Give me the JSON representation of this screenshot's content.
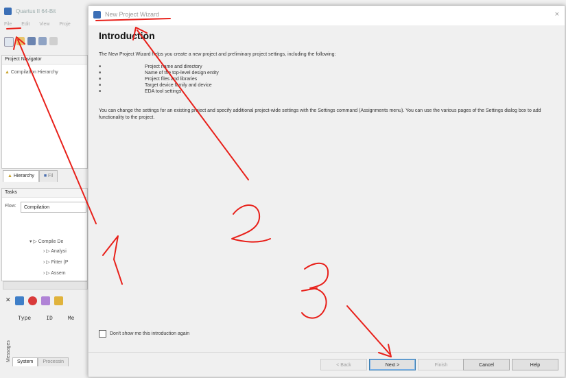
{
  "main_window": {
    "title": "Quartus II 64-Bit",
    "menu": [
      "File",
      "Edit",
      "View",
      "Proje"
    ],
    "project_navigator": "Project Navigator",
    "compilation_hierarchy": "Compilation Hierarchy",
    "tabs": [
      "Hierarchy",
      "Fil"
    ],
    "tasks_label": "Tasks",
    "flow_label": "Flow:",
    "flow_value": "Compilation",
    "task_rows": [
      "Compile De",
      "Analysi",
      "Fitter (P",
      "Assem"
    ],
    "messages_columns": [
      "Type",
      "ID",
      "Me"
    ],
    "messages_side_label": "Messages",
    "bottom_tabs": [
      "System",
      "Processin"
    ]
  },
  "dialog": {
    "title": "New Project Wizard",
    "close_glyph": "×",
    "heading": "Introduction",
    "intro": "The New Project Wizard helps you create a new project and preliminary project settings, including the following:",
    "bullets": [
      "Project name and directory",
      "Name of the top-level design entity",
      "Project files and libraries",
      "Target device family and device",
      "EDA tool settings"
    ],
    "paragraph": "You can change the settings for an existing project and specify additional project-wide settings with the Settings command (Assignments menu). You can use the various pages of the Settings dialog box to add functionality to the project.",
    "checkbox_label": "Don't show me this introduction again",
    "buttons": {
      "back": "< Back",
      "next": "Next >",
      "finish": "Finish",
      "cancel": "Cancel",
      "help": "Help"
    }
  },
  "annotations": [
    "1",
    "2",
    "3"
  ],
  "colors": {
    "annotation": "#e8201a",
    "accent": "#3c7fb1"
  }
}
